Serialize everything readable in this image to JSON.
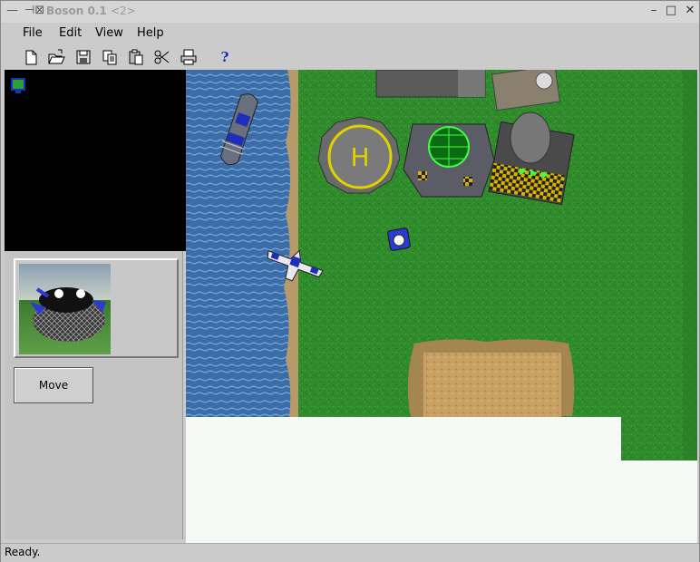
{
  "window": {
    "title": "Boson 0.1",
    "suffix": "<2>"
  },
  "menu": {
    "items": [
      "File",
      "Edit",
      "View",
      "Help"
    ]
  },
  "toolbar": {
    "tools": [
      "new-file-icon",
      "open-file-icon",
      "save-icon",
      "copy-icon",
      "paste-icon",
      "cut-icon",
      "print-icon",
      "help-icon"
    ],
    "help_label": "?"
  },
  "unit_panel": {
    "move_label": "Move"
  },
  "status": {
    "text": "Ready."
  },
  "colors": {
    "water": "#3b6ea8",
    "grass": "#2f8a2b",
    "sand": "#c9a064",
    "minimap_bg": "#000000"
  }
}
